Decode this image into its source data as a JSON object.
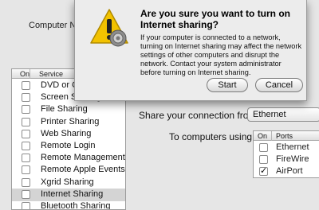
{
  "window": {
    "computer_name_label": "Computer N",
    "computer_name_value": ""
  },
  "services": {
    "header_on": "On",
    "header_service": "Service",
    "items": [
      {
        "label": "DVD or CD Sharing",
        "checked": false,
        "selected": false
      },
      {
        "label": "Screen Sharing",
        "checked": false,
        "selected": false
      },
      {
        "label": "File Sharing",
        "checked": false,
        "selected": false
      },
      {
        "label": "Printer Sharing",
        "checked": false,
        "selected": false
      },
      {
        "label": "Web Sharing",
        "checked": false,
        "selected": false
      },
      {
        "label": "Remote Login",
        "checked": false,
        "selected": false
      },
      {
        "label": "Remote Management",
        "checked": false,
        "selected": false
      },
      {
        "label": "Remote Apple Events",
        "checked": false,
        "selected": false
      },
      {
        "label": "Xgrid Sharing",
        "checked": false,
        "selected": false
      },
      {
        "label": "Internet Sharing",
        "checked": false,
        "selected": true
      },
      {
        "label": "Bluetooth Sharing",
        "checked": false,
        "selected": false
      }
    ]
  },
  "internet_sharing": {
    "share_from_label": "Share your connection from:",
    "share_from_value": "Ethernet",
    "to_computers_label": "To computers using:",
    "ports_header_on": "On",
    "ports_header_ports": "Ports",
    "ports": [
      {
        "label": "Ethernet",
        "checked": false
      },
      {
        "label": "FireWire",
        "checked": false
      },
      {
        "label": "AirPort",
        "checked": true
      }
    ]
  },
  "dialog": {
    "title": "Are you sure you want to turn on Internet sharing?",
    "body": "If your computer is connected to a network, turning on Internet sharing may affect the network settings of other computers and disrupt the network. Contact your system administrator before turning on Internet sharing.",
    "start_label": "Start",
    "cancel_label": "Cancel",
    "icon": "warning-icon"
  },
  "colors": {
    "dialog_bg": "#ececec",
    "window_bg": "#e6e6e6",
    "selected_row": "#d4d4d4",
    "warning_yellow": "#f2c200"
  }
}
